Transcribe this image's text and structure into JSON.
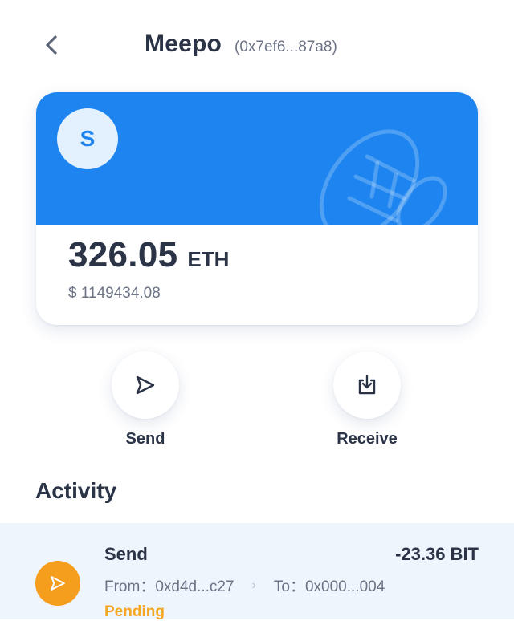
{
  "header": {
    "title": "Meepo",
    "address": "(0x7ef6...87a8)",
    "back_icon": "chevron-left-icon"
  },
  "card": {
    "avatar_letter": "S",
    "balance": "326.05",
    "unit": "ETH",
    "fiat": "$ 1149434.08",
    "accent_color": "#1e85f0"
  },
  "actions": {
    "send_label": "Send",
    "send_icon": "paper-plane-icon",
    "receive_label": "Receive",
    "receive_icon": "download-tray-icon"
  },
  "activity": {
    "title": "Activity",
    "items": [
      {
        "type": "Send",
        "amount": "-23.36 BIT",
        "from": "From：0xd4d...c27",
        "separator": "›",
        "to": "To：0x000...004",
        "status": "Pending",
        "status_color": "#f5a623",
        "icon": "paper-plane-icon",
        "icon_bg": "#f59d1d"
      }
    ]
  }
}
